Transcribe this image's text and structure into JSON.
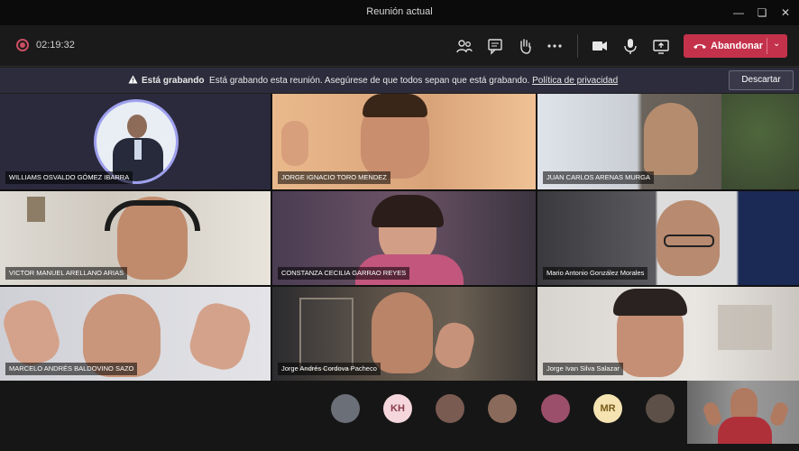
{
  "window": {
    "title": "Reunión actual"
  },
  "toolbar": {
    "timer": "02:19:32",
    "leave_label": "Abandonar",
    "icons": [
      "participants-icon",
      "chat-icon",
      "raise-hand-icon",
      "more-options-icon",
      "camera-icon",
      "microphone-icon",
      "share-screen-icon"
    ]
  },
  "banner": {
    "title": "Está grabando",
    "message": "Está grabando esta reunión. Asegúrese de que todos sepan que está grabando.",
    "policy_link": "Política de privacidad",
    "dismiss_label": "Descartar"
  },
  "participants": [
    {
      "name": "WILLIAMS OSVALDO GÓMEZ IBARRA"
    },
    {
      "name": "JORGE IGNACIO TORO MENDEZ"
    },
    {
      "name": "JUAN CARLOS ARENAS MURGA"
    },
    {
      "name": "VICTOR MANUEL ARELLANO ARIAS"
    },
    {
      "name": "CONSTANZA CECILIA GARRAO REYES"
    },
    {
      "name": "Mario Antonio González Morales"
    },
    {
      "name": "MARCELO ANDRÉS BALDOVINO SAZO"
    },
    {
      "name": "Jorge Andrés Cordova Pacheco"
    },
    {
      "name": "Jorge Ivan Silva Salazar"
    }
  ],
  "overflow_avatars": [
    {
      "initials": "",
      "color": "#6b6f78"
    },
    {
      "initials": "KH",
      "color": "#f4d6dc"
    },
    {
      "initials": "",
      "color": "#7a5b52"
    },
    {
      "initials": "",
      "color": "#8a6a5a"
    },
    {
      "initials": "",
      "color": "#9b4f6a"
    },
    {
      "initials": "MR",
      "color": "#f5e3b2"
    },
    {
      "initials": "",
      "color": "#5c5048"
    }
  ],
  "colors": {
    "leave": "#c4314b",
    "banner": "#2d2c3c",
    "recording": "#c94f62"
  }
}
